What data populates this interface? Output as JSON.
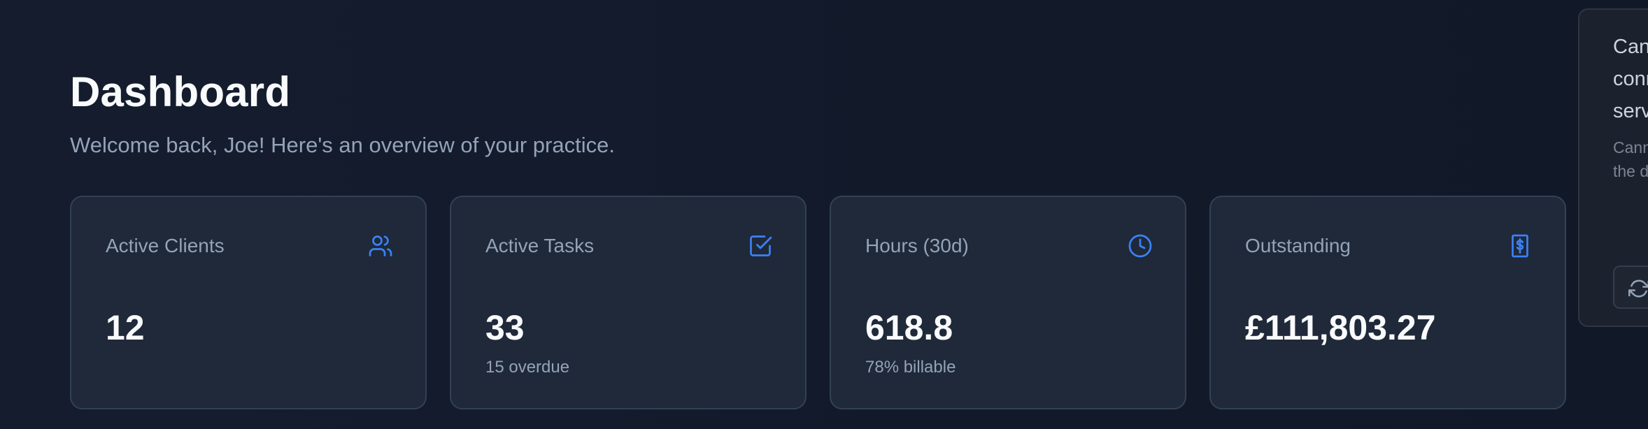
{
  "header": {
    "title": "Dashboard",
    "subtitle": "Welcome back, Joe! Here's an overview of your practice."
  },
  "colors": {
    "background": "#131b2c",
    "card": "#1f2939",
    "card_border": "#334155",
    "accent": "#3b82f6",
    "text_primary": "#f8fafc",
    "text_secondary": "#94a3b8"
  },
  "stats": [
    {
      "label": "Active Clients",
      "value": "12",
      "sub": "",
      "icon": "users-icon"
    },
    {
      "label": "Active Tasks",
      "value": "33",
      "sub": "15 overdue",
      "icon": "check-square-icon"
    },
    {
      "label": "Hours (30d)",
      "value": "618.8",
      "sub": "78% billable",
      "icon": "clock-icon"
    },
    {
      "label": "Outstanding",
      "value": "£111,803.27",
      "sub": "",
      "icon": "invoice-icon"
    }
  ],
  "toast": {
    "title": "Cannot connect to server",
    "message": "Cannot connect to the data server",
    "retry_icon": "refresh-icon"
  }
}
